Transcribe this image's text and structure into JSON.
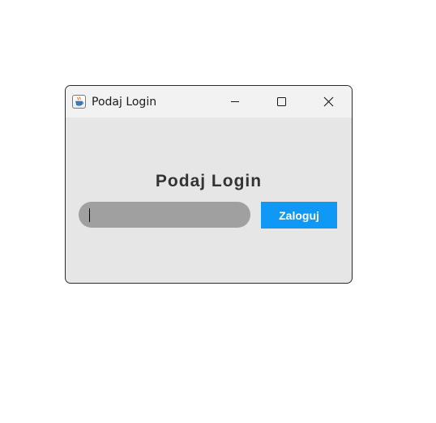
{
  "window": {
    "title": "Podaj Login",
    "icon": "java-cup-icon",
    "controls": {
      "minimize": "minimize-icon",
      "maximize": "maximize-icon",
      "close": "close-icon"
    }
  },
  "content": {
    "heading": "Podaj Login",
    "login_input": {
      "value": "",
      "placeholder": ""
    },
    "login_button_label": "Zaloguj"
  },
  "colors": {
    "content_background": "#e6e6e6",
    "title_bar": "#f2f2f2",
    "input_background": "#a0a0a0",
    "button_background": "#0f98f5",
    "heading_text": "#333333"
  }
}
